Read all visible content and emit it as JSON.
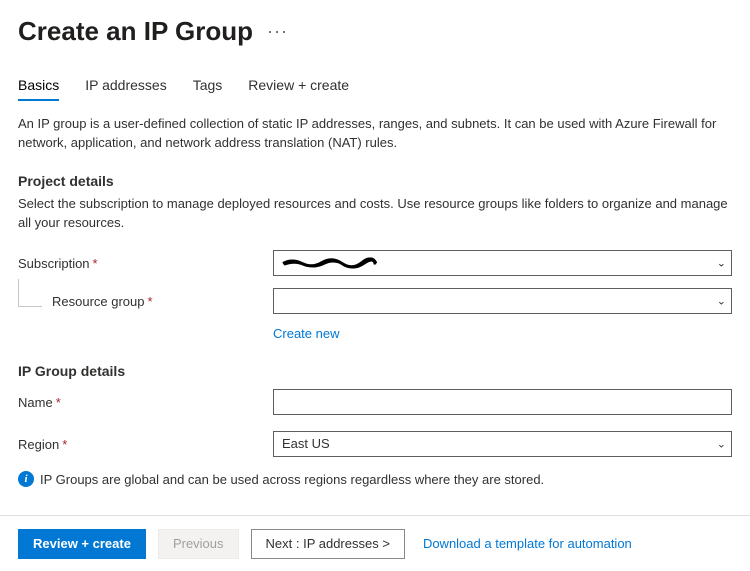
{
  "header": {
    "title": "Create an IP Group"
  },
  "tabs": [
    {
      "label": "Basics",
      "active": true
    },
    {
      "label": "IP addresses",
      "active": false
    },
    {
      "label": "Tags",
      "active": false
    },
    {
      "label": "Review + create",
      "active": false
    }
  ],
  "intro": "An IP group is a user-defined collection of static IP addresses, ranges, and subnets. It can be used with Azure Firewall for network, application, and network address translation (NAT) rules.",
  "project": {
    "section_title": "Project details",
    "section_desc": "Select the subscription to manage deployed resources and costs. Use resource groups like folders to organize and manage all your resources.",
    "subscription_label": "Subscription",
    "subscription_value": "",
    "resource_group_label": "Resource group",
    "resource_group_value": "",
    "create_new": "Create new"
  },
  "ipgroup": {
    "section_title": "IP Group details",
    "name_label": "Name",
    "name_value": "",
    "region_label": "Region",
    "region_value": "East US"
  },
  "info_text": "IP Groups are global and can be used across regions regardless where they are stored.",
  "footer": {
    "review_create": "Review + create",
    "previous": "Previous",
    "next": "Next : IP addresses >",
    "download_template": "Download a template for automation"
  }
}
